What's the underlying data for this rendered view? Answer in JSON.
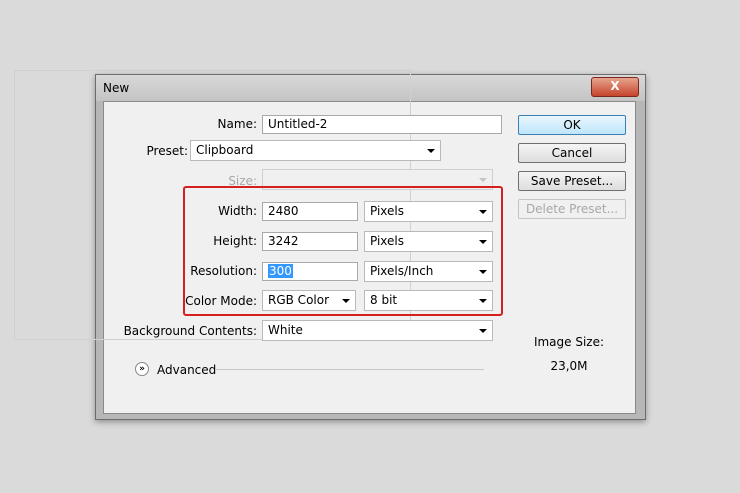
{
  "dialog": {
    "title": "New",
    "close_icon": "X"
  },
  "name": {
    "label": "Name:",
    "value": "Untitled-2"
  },
  "preset": {
    "label": "Preset:",
    "value": "Clipboard"
  },
  "size": {
    "label": "Size:",
    "value": ""
  },
  "width": {
    "label": "Width:",
    "value": "2480",
    "unit": "Pixels"
  },
  "height": {
    "label": "Height:",
    "value": "3242",
    "unit": "Pixels"
  },
  "resolution": {
    "label": "Resolution:",
    "value": "300",
    "unit": "Pixels/Inch"
  },
  "color_mode": {
    "label": "Color Mode:",
    "value": "RGB Color",
    "depth": "8 bit"
  },
  "background": {
    "label": "Background Contents:",
    "value": "White"
  },
  "advanced": {
    "label": "Advanced",
    "icon": "chevron-double-down-icon"
  },
  "buttons": {
    "ok": "OK",
    "cancel": "Cancel",
    "save_preset": "Save Preset...",
    "delete_preset": "Delete Preset..."
  },
  "image_size": {
    "label": "Image Size:",
    "value": "23,0M"
  },
  "colors": {
    "highlight": "#d62020",
    "selection": "#3399ff",
    "default_button": "#bee6fd"
  }
}
